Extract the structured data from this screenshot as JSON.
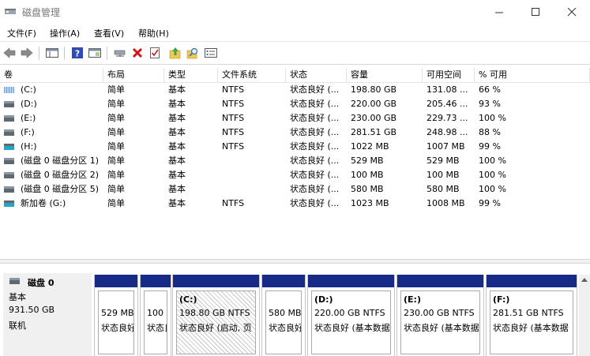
{
  "window": {
    "title": "磁盘管理"
  },
  "menu": [
    "文件(F)",
    "操作(A)",
    "查看(V)",
    "帮助(H)"
  ],
  "columns": [
    "卷",
    "布局",
    "类型",
    "文件系统",
    "状态",
    "容量",
    "可用空间",
    "% 可用"
  ],
  "volumes": [
    {
      "name": "(C:)",
      "layout": "简单",
      "type": "基本",
      "fs": "NTFS",
      "status": "状态良好 (...",
      "capacity": "198.80 GB",
      "free": "131.08 ...",
      "pct": "66 %",
      "icon": "system-drive-icon"
    },
    {
      "name": "(D:)",
      "layout": "简单",
      "type": "基本",
      "fs": "NTFS",
      "status": "状态良好 (...",
      "capacity": "220.00 GB",
      "free": "205.46 ...",
      "pct": "93 %",
      "icon": "drive-icon"
    },
    {
      "name": "(E:)",
      "layout": "简单",
      "type": "基本",
      "fs": "NTFS",
      "status": "状态良好 (...",
      "capacity": "230.00 GB",
      "free": "229.73 ...",
      "pct": "100 %",
      "icon": "drive-icon"
    },
    {
      "name": "(F:)",
      "layout": "简单",
      "type": "基本",
      "fs": "NTFS",
      "status": "状态良好 (...",
      "capacity": "281.51 GB",
      "free": "248.98 ...",
      "pct": "88 %",
      "icon": "drive-icon"
    },
    {
      "name": "(H:)",
      "layout": "简单",
      "type": "基本",
      "fs": "NTFS",
      "status": "状态良好 (...",
      "capacity": "1022 MB",
      "free": "1007 MB",
      "pct": "99 %",
      "icon": "removable-drive-icon"
    },
    {
      "name": "(磁盘 0 磁盘分区 1)",
      "layout": "简单",
      "type": "基本",
      "fs": "",
      "status": "状态良好 (...",
      "capacity": "529 MB",
      "free": "529 MB",
      "pct": "100 %",
      "icon": "drive-icon"
    },
    {
      "name": "(磁盘 0 磁盘分区 2)",
      "layout": "简单",
      "type": "基本",
      "fs": "",
      "status": "状态良好 (...",
      "capacity": "100 MB",
      "free": "100 MB",
      "pct": "100 %",
      "icon": "drive-icon"
    },
    {
      "name": "(磁盘 0 磁盘分区 5)",
      "layout": "简单",
      "type": "基本",
      "fs": "",
      "status": "状态良好 (...",
      "capacity": "580 MB",
      "free": "580 MB",
      "pct": "100 %",
      "icon": "drive-icon"
    },
    {
      "name": "新加卷 (G:)",
      "layout": "简单",
      "type": "基本",
      "fs": "NTFS",
      "status": "状态良好 (...",
      "capacity": "1023 MB",
      "free": "1008 MB",
      "pct": "99 %",
      "icon": "removable-drive-icon"
    }
  ],
  "disk": {
    "name": "磁盘 0",
    "kind": "基本",
    "size": "931.50 GB",
    "state": "联机"
  },
  "partitions": [
    {
      "label": "",
      "size": "529 MB",
      "status": "状态良好"
    },
    {
      "label": "",
      "size": "100",
      "status": "状态良好"
    },
    {
      "label": "(C:)",
      "size": "198.80 GB NTFS",
      "status": "状态良好 (启动, 页"
    },
    {
      "label": "",
      "size": "580 MB",
      "status": "状态良好"
    },
    {
      "label": "(D:)",
      "size": "220.00 GB NTFS",
      "status": "状态良好 (基本数据"
    },
    {
      "label": "(E:)",
      "size": "230.00 GB NTFS",
      "status": "状态良好 (基本数据"
    },
    {
      "label": "(F:)",
      "size": "281.51 GB NTFS",
      "status": "状态良好 (基本数据"
    }
  ],
  "colors": {
    "partition_bar": "#172b86",
    "drive_cyan": "#21a6c9"
  }
}
